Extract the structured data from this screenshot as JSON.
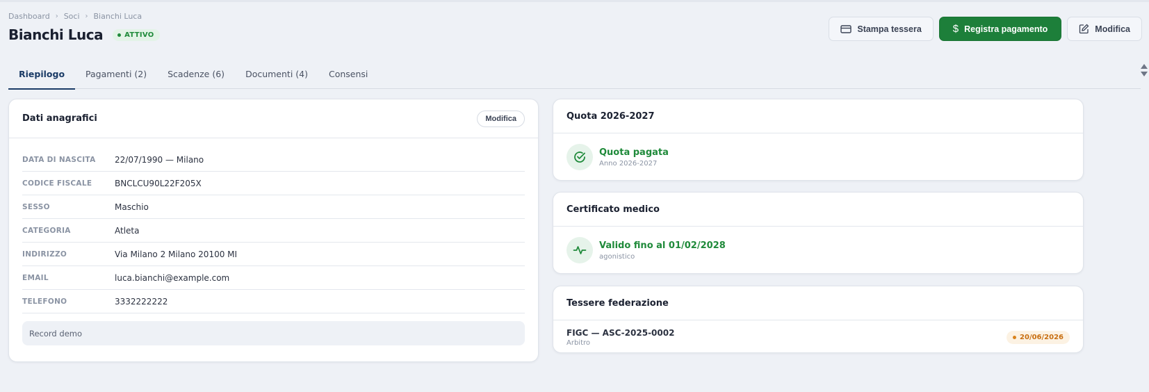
{
  "breadcrumb": [
    "Dashboard",
    "Soci",
    "Bianchi Luca"
  ],
  "member": {
    "name": "Bianchi Luca",
    "status": "ATTIVO"
  },
  "actions": {
    "print_card": "Stampa tessera",
    "register_payment": "Registra pagamento",
    "edit": "Modifica"
  },
  "tabs": [
    {
      "label": "Riepilogo",
      "active": true
    },
    {
      "label": "Pagamenti (2)"
    },
    {
      "label": "Scadenze (6)"
    },
    {
      "label": "Documenti (4)"
    },
    {
      "label": "Consensi"
    }
  ],
  "personal": {
    "title": "Dati anagrafici",
    "edit_label": "Modifica",
    "fields": [
      {
        "key": "DATA DI NASCITA",
        "value": "22/07/1990 — Milano"
      },
      {
        "key": "CODICE FISCALE",
        "value": "BNCLCU90L22F205X"
      },
      {
        "key": "SESSO",
        "value": "Maschio"
      },
      {
        "key": "CATEGORIA",
        "value": "Atleta"
      },
      {
        "key": "INDIRIZZO",
        "value": "Via Milano 2 Milano 20100 MI"
      },
      {
        "key": "EMAIL",
        "value": "luca.bianchi@example.com"
      },
      {
        "key": "TELEFONO",
        "value": "3332222222"
      }
    ],
    "note": "Record demo"
  },
  "quota": {
    "title": "Quota 2026-2027",
    "status": "Quota pagata",
    "sub": "Anno 2026-2027",
    "icon": "check-circle-icon"
  },
  "certificate": {
    "title": "Certificato medico",
    "status": "Valido fino al 01/02/2028",
    "sub": "agonistico",
    "icon": "heartbeat-icon"
  },
  "federation": {
    "title": "Tessere federazione",
    "items": [
      {
        "name": "FIGC — ASC-2025-0002",
        "role": "Arbitro",
        "expiry": "20/06/2026"
      }
    ]
  },
  "colors": {
    "primary": "#1d7f3a",
    "accent_navy": "#1a3b66",
    "warning": "#c86e10",
    "background": "#eef1f6"
  }
}
